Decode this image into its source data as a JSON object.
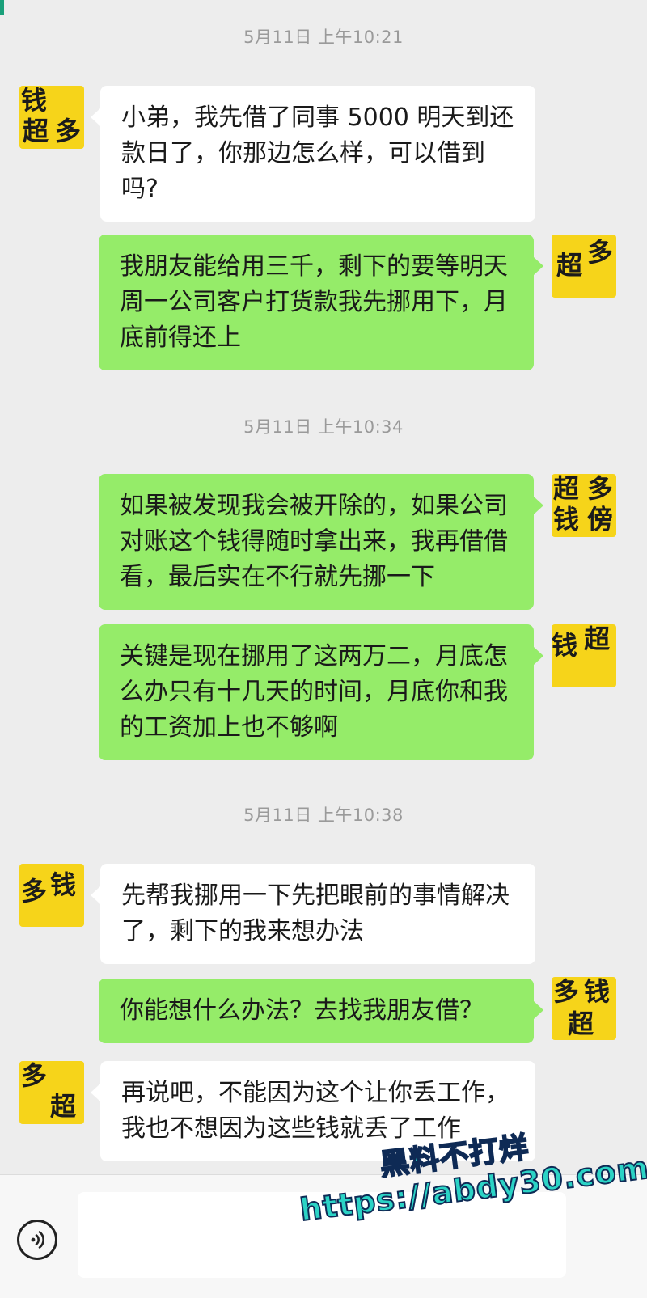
{
  "messages": [
    {
      "type": "time",
      "text": "5月11日 上午10:21"
    },
    {
      "type": "in",
      "text": "小弟，我先借了同事 5000 明天到还款日了，你那边怎么样，可以借到吗?"
    },
    {
      "type": "out",
      "text": "我朋友能给用三千，剩下的要等明天周一公司客户打货款我先挪用下，月底前得还上"
    },
    {
      "type": "time",
      "text": "5月11日 上午10:34"
    },
    {
      "type": "out",
      "text": "如果被发现我会被开除的，如果公司对账这个钱得随时拿出来，我再借借看，最后实在不行就先挪一下"
    },
    {
      "type": "out",
      "text": "关键是现在挪用了这两万二，月底怎么办只有十几天的时间，月底你和我的工资加上也不够啊"
    },
    {
      "type": "time",
      "text": "5月11日 上午10:38"
    },
    {
      "type": "in",
      "text": "先帮我挪用一下先把眼前的事情解决了，剩下的我来想办法"
    },
    {
      "type": "out",
      "text": "你能想什么办法？去找我朋友借？"
    },
    {
      "type": "in",
      "text": "再说吧，不能因为这个让你丢工作，我也不想因为这些钱就丢了工作"
    }
  ],
  "avatar_glyphs": [
    "超",
    "多",
    "钱",
    "傍"
  ],
  "input": {
    "placeholder": ""
  },
  "watermark": {
    "line1": "黑料不打烊",
    "line2": "https://abdy30.com"
  },
  "icons": {
    "voice": "voice-icon"
  },
  "colors": {
    "background": "#ededed",
    "outgoing_bubble": "#95ec69",
    "incoming_bubble": "#ffffff",
    "avatar": "#f6d41a",
    "watermark": "#2bd3c5"
  }
}
